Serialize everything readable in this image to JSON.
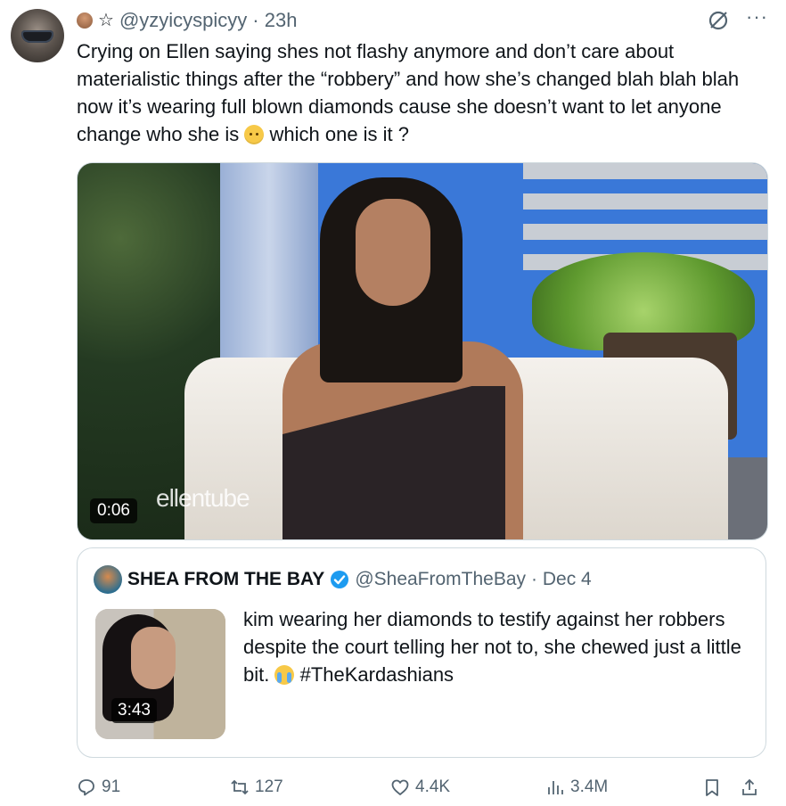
{
  "tweet": {
    "handle": "@yzyicyspicyy",
    "time": "· 23h",
    "text_part1": "Crying on Ellen saying shes not flashy anymore and don’t care about materialistic things after the “robbery” and how she’s changed blah blah blah now it’s wearing full blown diamonds cause she doesn’t want to let anyone change who she is",
    "text_part2": "which one is it ?",
    "emoji_sad": "pensive-face-emoji"
  },
  "media": {
    "duration": "0:06",
    "watermark": "ellentube"
  },
  "quote": {
    "name": "SHEA FROM THE BAY",
    "handle": "@SheaFromTheBay",
    "date": "· Dec 4",
    "text_part1": "kim wearing her diamonds to testify against her robbers despite the court telling her not to, she chewed just a little bit.",
    "hashtag": "#TheKardashians",
    "thumb_duration": "3:43",
    "verified_color": "#1d9bf0"
  },
  "actions": {
    "replies": "91",
    "reposts": "127",
    "likes": "4.4K",
    "views": "3.4M"
  },
  "icons": [
    "star-icon",
    "grok-icon",
    "more-icon",
    "reply-icon",
    "repost-icon",
    "like-icon",
    "views-icon",
    "bookmark-icon",
    "share-icon",
    "verified-icon"
  ]
}
